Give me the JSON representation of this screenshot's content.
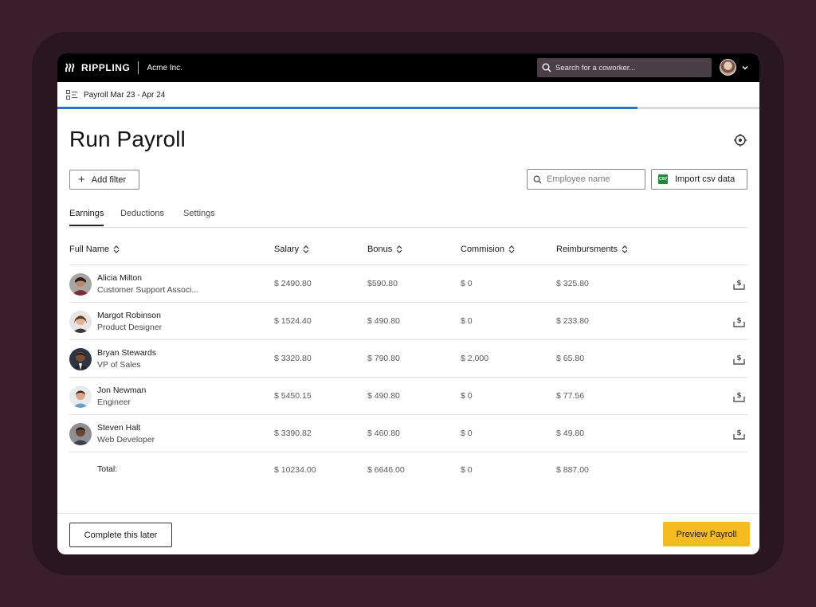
{
  "app": {
    "brand": "RIPPLING",
    "company": "Acme Inc.",
    "search_placeholder": "Search for a coworker..."
  },
  "subheader": {
    "label": "Payroll Mar 23 - Apr 24",
    "progress_fraction": 0.826
  },
  "page": {
    "title": "Run Payroll",
    "add_filter_label": "Add filter",
    "employee_search_placeholder": "Employee name",
    "import_label": "Import csv data",
    "csv_badge": "CSV"
  },
  "tabs": [
    {
      "label": "Earnings",
      "active": true
    },
    {
      "label": "Deductions",
      "active": false
    },
    {
      "label": "Settings",
      "active": false
    }
  ],
  "table": {
    "columns": [
      "Full Name",
      "Salary",
      "Bonus",
      "Commision",
      "Reimbursments"
    ],
    "rows": [
      {
        "name": "Alicia Milton",
        "role": "Customer Support Associ...",
        "salary": "$ 2490.80",
        "bonus": "$590.80",
        "commission": "$ 0",
        "reimbursements": "$ 325.80"
      },
      {
        "name": "Margot Robinson",
        "role": "Product Designer",
        "salary": "$ 1524.40",
        "bonus": "$ 490.80",
        "commission": "$ 0",
        "reimbursements": "$ 233.80"
      },
      {
        "name": "Bryan Stewards",
        "role": "VP of Sales",
        "salary": "$ 3320.80",
        "bonus": "$ 790.80",
        "commission": "$ 2,000",
        "reimbursements": "$ 65.80"
      },
      {
        "name": "Jon Newman",
        "role": "Engineer",
        "salary": "$ 5450.15",
        "bonus": "$ 490.80",
        "commission": "$ 0",
        "reimbursements": "$ 77.56"
      },
      {
        "name": "Steven Halt",
        "role": "Web Developer",
        "salary": "$ 3390.82",
        "bonus": "$ 460.80",
        "commission": "$ 0",
        "reimbursements": "$ 49.80"
      }
    ],
    "total": {
      "label": "Total:",
      "salary": "$ 10234.00",
      "bonus": "$ 6646.00",
      "commission": "$ 0",
      "reimbursements": "$ 887.00"
    }
  },
  "footer": {
    "later_label": "Complete this later",
    "preview_label": "Preview Payroll"
  },
  "colors": {
    "accent_yellow": "#f6bb21",
    "progress_blue": "#2a74c9",
    "csv_green": "#1f8a3a",
    "topbar_black": "#000000"
  }
}
